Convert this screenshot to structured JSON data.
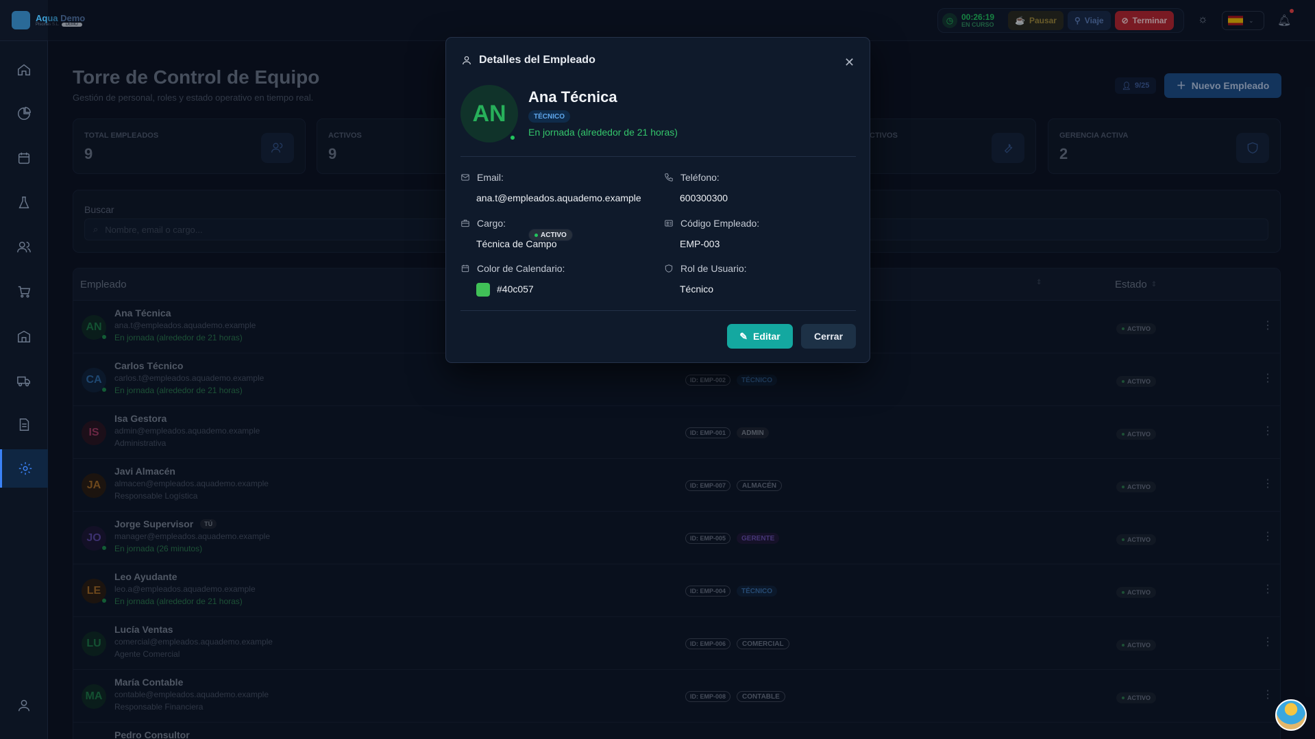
{
  "app": {
    "logo_main": "Aqua",
    "logo_accent": "Demo",
    "logo_sub": "Piscinas S.L.",
    "logo_tag": "DEMO"
  },
  "header": {
    "timer_value": "00:26:19",
    "timer_status": "EN CURSO",
    "pause_label": "Pausar",
    "trip_label": "Viaje",
    "end_label": "Terminar"
  },
  "page": {
    "title": "Torre de Control de Equipo",
    "subtitle": "Gestión de personal, roles y estado operativo en tiempo real.",
    "count_badge": "9/25",
    "new_button": "Nuevo Empleado"
  },
  "stats": [
    {
      "label": "TOTAL EMPLEADOS",
      "value": "9"
    },
    {
      "label": "ACTIVOS",
      "value": "9"
    },
    {
      "label": "CTIVOS",
      "value": ""
    },
    {
      "label": "GERENCIA ACTIVA",
      "value": "2"
    }
  ],
  "search": {
    "label": "Buscar",
    "placeholder": "Nombre, email o cargo..."
  },
  "table": {
    "col_employee": "Empleado",
    "col_status": "Estado",
    "rows": [
      {
        "initials": "AN",
        "name": "Ana Técnica",
        "email": "ana.t@empleados.aquademo.example",
        "sub": "En jornada (alrededor de 21 horas)",
        "id": "",
        "role": "",
        "status": "ACTIVO"
      },
      {
        "initials": "CA",
        "name": "Carlos Técnico",
        "email": "carlos.t@empleados.aquademo.example",
        "sub": "En jornada (alrededor de 21 horas)",
        "id": "ID: EMP-002",
        "role": "TÉCNICO",
        "status": "ACTIVO"
      },
      {
        "initials": "IS",
        "name": "Isa Gestora",
        "email": "admin@empleados.aquademo.example",
        "sub": "Administrativa",
        "id": "ID: EMP-001",
        "role": "ADMIN",
        "status": "ACTIVO"
      },
      {
        "initials": "JA",
        "name": "Javi Almacén",
        "email": "almacen@empleados.aquademo.example",
        "sub": "Responsable Logística",
        "id": "ID: EMP-007",
        "role": "ALMACÉN",
        "status": "ACTIVO"
      },
      {
        "initials": "JO",
        "name": "Jorge Supervisor",
        "badge": "TÚ",
        "email": "manager@empleados.aquademo.example",
        "sub": "En jornada (26 minutos)",
        "id": "ID: EMP-005",
        "role": "GERENTE",
        "status": "ACTIVO"
      },
      {
        "initials": "LE",
        "name": "Leo Ayudante",
        "email": "leo.a@empleados.aquademo.example",
        "sub": "En jornada (alrededor de 21 horas)",
        "id": "ID: EMP-004",
        "role": "TÉCNICO",
        "status": "ACTIVO"
      },
      {
        "initials": "LU",
        "name": "Lucía Ventas",
        "email": "comercial@empleados.aquademo.example",
        "sub": "Agente Comercial",
        "id": "ID: EMP-006",
        "role": "COMERCIAL",
        "status": "ACTIVO"
      },
      {
        "initials": "MA",
        "name": "María Contable",
        "email": "contable@empleados.aquademo.example",
        "sub": "Responsable Financiera",
        "id": "ID: EMP-008",
        "role": "CONTABLE",
        "status": "ACTIVO"
      },
      {
        "initials": "",
        "name": "Pedro Consultor",
        "email": "",
        "sub": "",
        "id": "",
        "role": "",
        "status": ""
      }
    ]
  },
  "modal": {
    "title": "Detalles del Empleado",
    "initials": "AN",
    "name": "Ana Técnica",
    "role_tag": "TÉCNICO",
    "status_tag": "ACTIVO",
    "shift": "En jornada (alrededor de 21 horas)",
    "email_label": "Email:",
    "email": "ana.t@empleados.aquademo.example",
    "phone_label": "Teléfono:",
    "phone": "600300300",
    "position_label": "Cargo:",
    "position": "Técnica de Campo",
    "code_label": "Código Empleado:",
    "code": "EMP-003",
    "color_label": "Color de Calendario:",
    "color": "#40c057",
    "user_role_label": "Rol de Usuario:",
    "user_role": "Técnico",
    "edit_button": "Editar",
    "close_button": "Cerrar"
  }
}
